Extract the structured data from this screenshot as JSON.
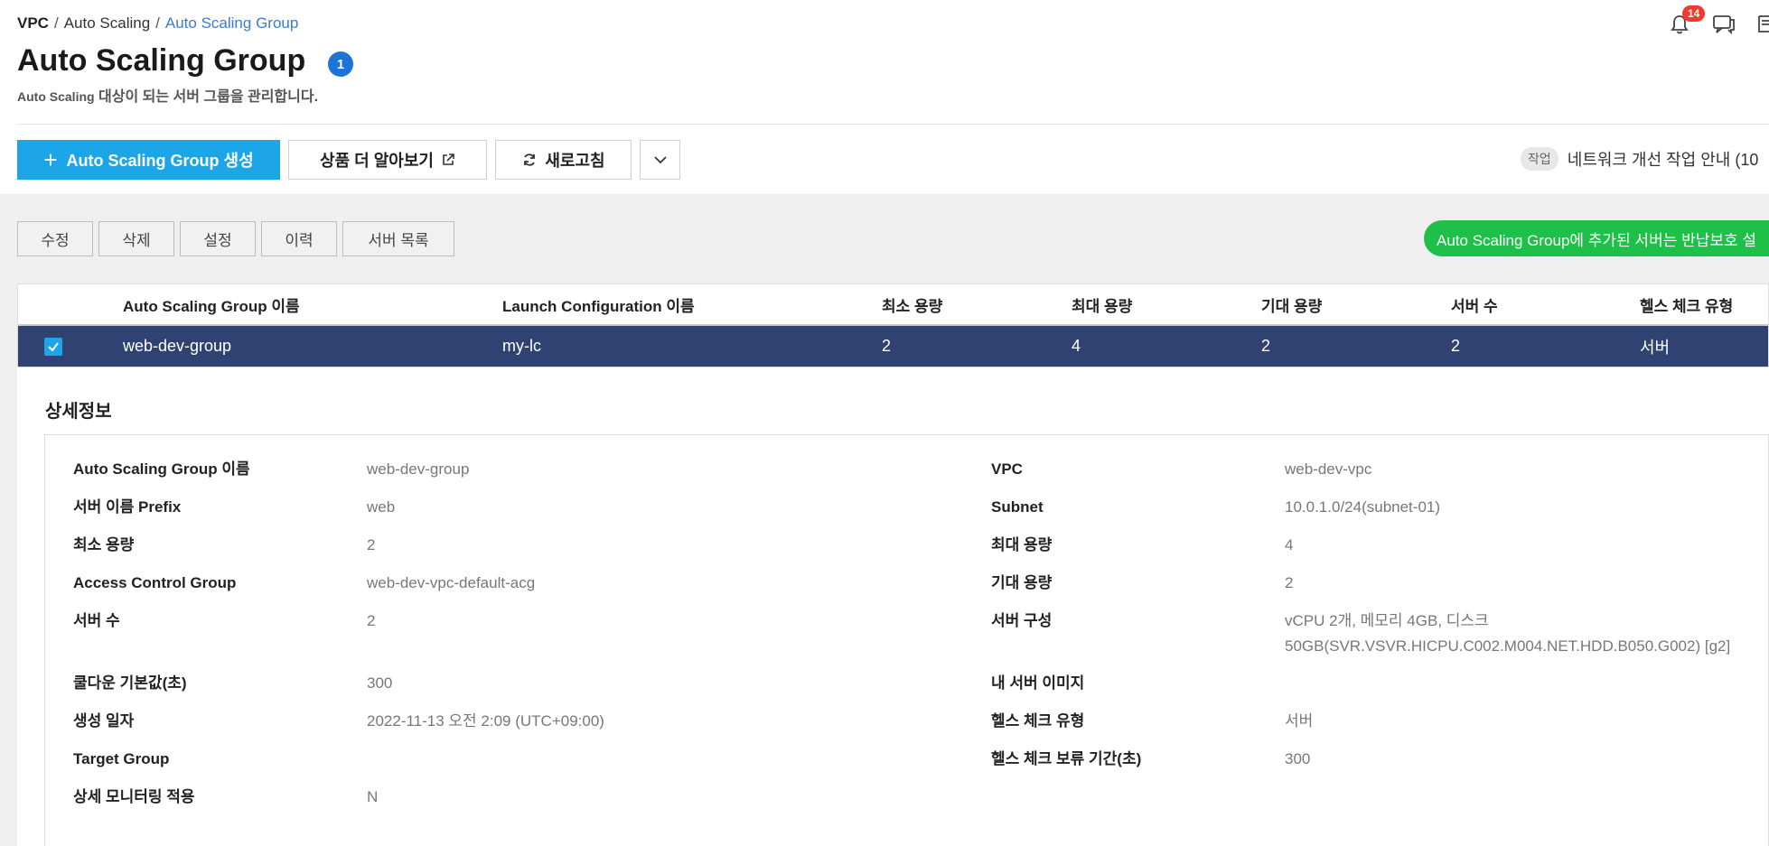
{
  "breadcrumb": {
    "item1": "VPC",
    "sep1": "/",
    "item2": "Auto Scaling",
    "sep2": "/",
    "item3": "Auto Scaling Group"
  },
  "notifications": {
    "count": "14"
  },
  "page": {
    "title": "Auto Scaling Group",
    "count": "1",
    "subtitle_en": "Auto Scaling",
    "subtitle_ko": " 대상이 되는 서버 그룹을 관리합니다."
  },
  "toolbar": {
    "create_plus": "+",
    "create_label": "Auto Scaling Group 생성",
    "more_label": "상품 더 알아보기",
    "refresh_label": "새로고침"
  },
  "notice": {
    "tag": "작업",
    "text": "네트워크 개선 작업 안내 (10"
  },
  "actions": [
    "수정",
    "삭제",
    "설정",
    "이력",
    "서버 목록"
  ],
  "green_notice": "Auto Scaling Group에 추가된 서버는 반납보호 설",
  "table": {
    "headers": [
      "Auto Scaling Group 이름",
      "Launch Configuration 이름",
      "최소 용량",
      "최대 용량",
      "기대 용량",
      "서버 수",
      "헬스 체크 유형"
    ],
    "row": [
      "web-dev-group",
      "my-lc",
      "2",
      "4",
      "2",
      "2",
      "서버"
    ]
  },
  "detail": {
    "title": "상세정보",
    "left": [
      {
        "label": "Auto Scaling Group 이름",
        "value": "web-dev-group"
      },
      {
        "label": "서버 이름 Prefix",
        "value": "web"
      },
      {
        "label": "최소 용량",
        "value": "2"
      },
      {
        "label": "Access Control Group",
        "value": "web-dev-vpc-default-acg"
      },
      {
        "label": "서버 수",
        "value": "2"
      },
      {
        "label": "쿨다운 기본값(초)",
        "value": "300"
      },
      {
        "label": "생성 일자",
        "value": "2022-11-13 오전 2:09 (UTC+09:00)"
      },
      {
        "label": "Target Group",
        "value": ""
      },
      {
        "label": "상세 모니터링 적용",
        "value": "N"
      }
    ],
    "right": [
      {
        "label": "VPC",
        "value": "web-dev-vpc"
      },
      {
        "label": "Subnet",
        "value": "10.0.1.0/24(subnet-01)"
      },
      {
        "label": "최대 용량",
        "value": "4"
      },
      {
        "label": "기대 용량",
        "value": "2"
      },
      {
        "label": "서버 구성",
        "value": "vCPU 2개, 메모리 4GB, 디스크",
        "value2": "50GB(SVR.VSVR.HICPU.C002.M004.NET.HDD.B050.G002) [g2]"
      },
      {
        "label": "내 서버 이미지",
        "value": ""
      },
      {
        "label": "헬스 체크 유형",
        "value": "서버"
      },
      {
        "label": "헬스 체크 보류 기간(초)",
        "value": "300"
      }
    ]
  }
}
